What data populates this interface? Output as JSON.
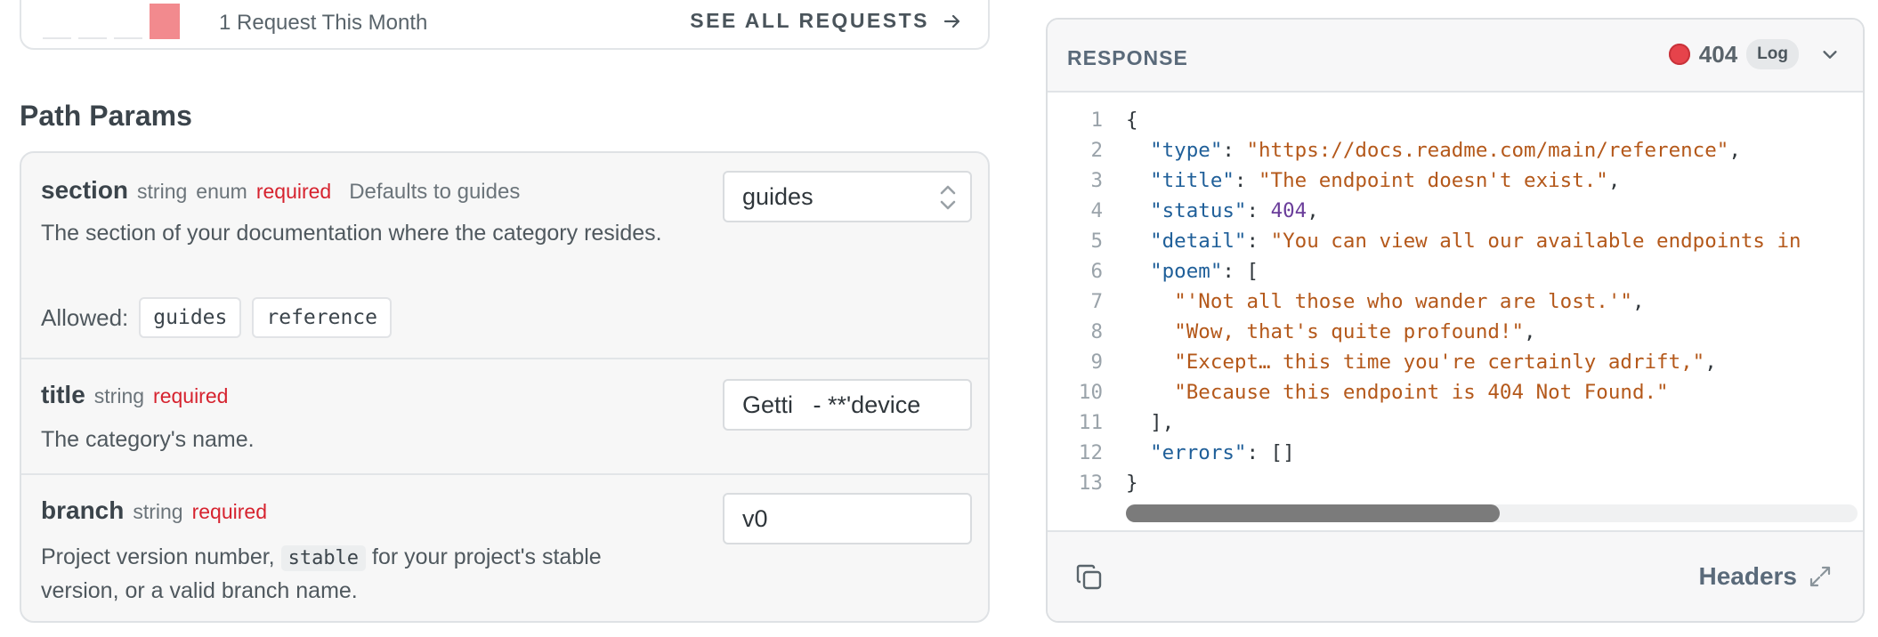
{
  "requests": {
    "count_text": "1 Request This Month",
    "see_all_label": "SEE ALL REQUESTS",
    "bar_color": "#f28a8e"
  },
  "path_params": {
    "heading": "Path Params",
    "params": [
      {
        "name": "section",
        "type": "string",
        "enum": "enum",
        "required": "required",
        "default": "Defaults to guides",
        "description": "The section of your documentation where the category resides.",
        "allowed_label": "Allowed:",
        "allowed": [
          "guides",
          "reference"
        ],
        "value": "guides",
        "input_kind": "select"
      },
      {
        "name": "title",
        "type": "string",
        "required": "required",
        "description": "The category's name.",
        "value": "Getti   - **'device",
        "input_kind": "text"
      },
      {
        "name": "branch",
        "type": "string",
        "required": "required",
        "description_before": "Project version number,",
        "description_code": "stable",
        "description_after": "for your project's stable version, or a valid branch name.",
        "value": "v0",
        "input_kind": "text"
      }
    ]
  },
  "response": {
    "title": "RESPONSE",
    "status_code": "404",
    "status_color": "#e6434b",
    "log_label": "Log",
    "headers_label": "Headers",
    "lines": [
      {
        "n": "1",
        "tokens": [
          {
            "t": "p",
            "v": "{"
          }
        ]
      },
      {
        "n": "2",
        "tokens": [
          {
            "t": "p",
            "v": "  "
          },
          {
            "t": "k",
            "v": "\"type\""
          },
          {
            "t": "p",
            "v": ": "
          },
          {
            "t": "s",
            "v": "\"https://docs.readme.com/main/reference\""
          },
          {
            "t": "p",
            "v": ","
          }
        ]
      },
      {
        "n": "3",
        "tokens": [
          {
            "t": "p",
            "v": "  "
          },
          {
            "t": "k",
            "v": "\"title\""
          },
          {
            "t": "p",
            "v": ": "
          },
          {
            "t": "s",
            "v": "\"The endpoint doesn't exist.\""
          },
          {
            "t": "p",
            "v": ","
          }
        ]
      },
      {
        "n": "4",
        "tokens": [
          {
            "t": "p",
            "v": "  "
          },
          {
            "t": "k",
            "v": "\"status\""
          },
          {
            "t": "p",
            "v": ": "
          },
          {
            "t": "n",
            "v": "404"
          },
          {
            "t": "p",
            "v": ","
          }
        ]
      },
      {
        "n": "5",
        "tokens": [
          {
            "t": "p",
            "v": "  "
          },
          {
            "t": "k",
            "v": "\"detail\""
          },
          {
            "t": "p",
            "v": ": "
          },
          {
            "t": "s",
            "v": "\"You can view all our available endpoints in"
          }
        ]
      },
      {
        "n": "6",
        "tokens": [
          {
            "t": "p",
            "v": "  "
          },
          {
            "t": "k",
            "v": "\"poem\""
          },
          {
            "t": "p",
            "v": ": ["
          }
        ]
      },
      {
        "n": "7",
        "tokens": [
          {
            "t": "p",
            "v": "    "
          },
          {
            "t": "s",
            "v": "\"'Not all those who wander are lost.'\""
          },
          {
            "t": "p",
            "v": ","
          }
        ]
      },
      {
        "n": "8",
        "tokens": [
          {
            "t": "p",
            "v": "    "
          },
          {
            "t": "s",
            "v": "\"Wow, that's quite profound!\""
          },
          {
            "t": "p",
            "v": ","
          }
        ]
      },
      {
        "n": "9",
        "tokens": [
          {
            "t": "p",
            "v": "    "
          },
          {
            "t": "s",
            "v": "\"Except… this time you're certainly adrift,\""
          },
          {
            "t": "p",
            "v": ","
          }
        ]
      },
      {
        "n": "10",
        "tokens": [
          {
            "t": "p",
            "v": "    "
          },
          {
            "t": "s",
            "v": "\"Because this endpoint is 404 Not Found.\""
          }
        ]
      },
      {
        "n": "11",
        "tokens": [
          {
            "t": "p",
            "v": "  ],"
          }
        ]
      },
      {
        "n": "12",
        "tokens": [
          {
            "t": "p",
            "v": "  "
          },
          {
            "t": "k",
            "v": "\"errors\""
          },
          {
            "t": "p",
            "v": ": []"
          }
        ]
      },
      {
        "n": "13",
        "tokens": [
          {
            "t": "p",
            "v": "}"
          }
        ]
      }
    ]
  }
}
